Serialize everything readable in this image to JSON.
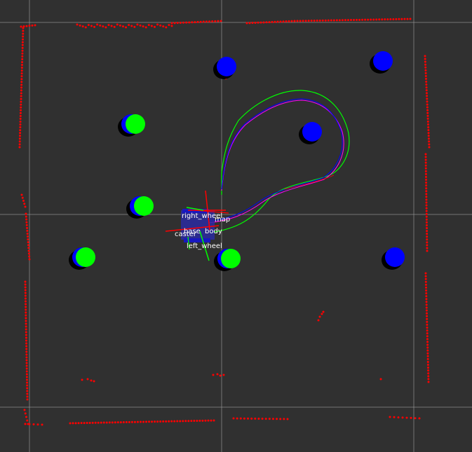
{
  "scene": {
    "background": "#303030",
    "grid_color": "#a0a0a0",
    "laser_color": "#ff0000",
    "obstacle_color": "#0000ff",
    "goal_color": "#00ff00",
    "shadow_color": "#000000"
  },
  "paths": {
    "planned_color": "#00ff00",
    "odom_color": "#0000ff",
    "estimate_color": "#ff00ff",
    "estimate_alt_color": "#ff0000"
  },
  "frames": {
    "right_wheel": "right_wheel",
    "map": "map",
    "caster": "caster",
    "base": "base",
    "body": "body",
    "left_wheel": "left_wheel"
  },
  "icons": {
    "robot": "robot-model-icon",
    "axes": "tf-axes-icon"
  }
}
